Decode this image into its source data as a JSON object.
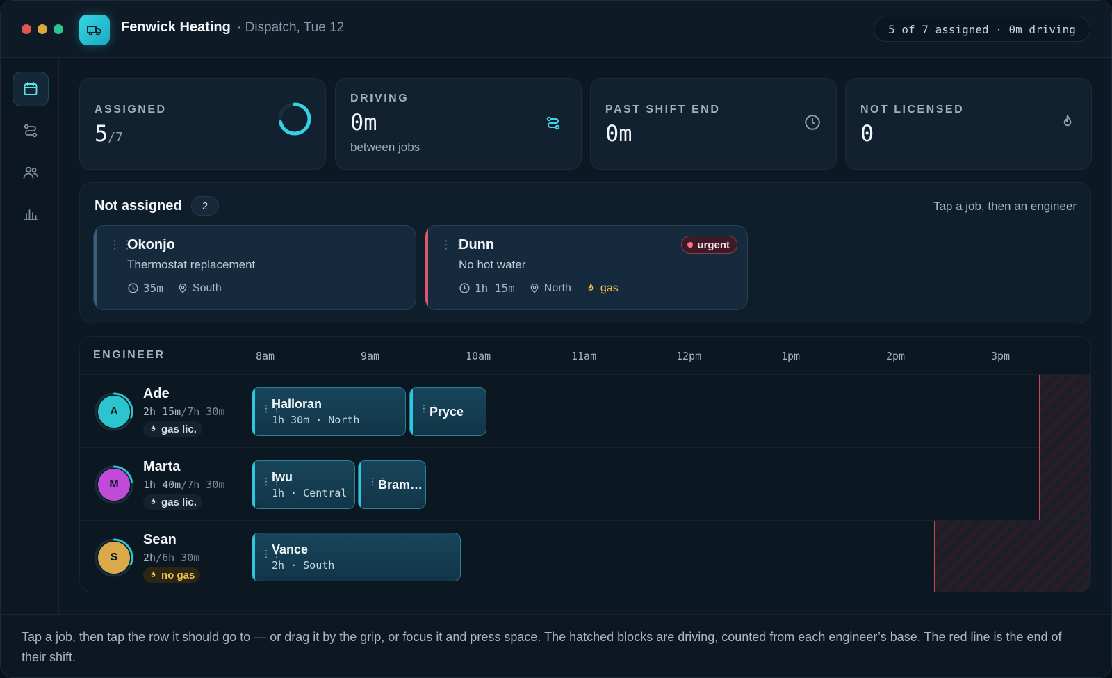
{
  "app": {
    "title": "Fenwick Heating",
    "subtitle": "· Dispatch, Tue 12",
    "summary": "5 of 7 assigned · 0m driving",
    "logo_icon": "van-icon"
  },
  "sidebar": {
    "items": [
      {
        "icon": "calendar-icon",
        "active": true
      },
      {
        "icon": "route-icon",
        "active": false
      },
      {
        "icon": "people-icon",
        "active": false
      },
      {
        "icon": "bar-chart-icon",
        "active": false
      }
    ]
  },
  "stats": {
    "assigned": {
      "label": "ASSIGNED",
      "value": "5",
      "denominator": "/7",
      "progress": 0.714
    },
    "driving": {
      "label": "DRIVING",
      "value": "0m",
      "note": "between jobs",
      "icon": "route-icon"
    },
    "past_shift": {
      "label": "PAST SHIFT END",
      "value": "0m",
      "icon": "clock-icon"
    },
    "not_licensed": {
      "label": "NOT LICENSED",
      "value": "0",
      "icon": "flame-icon"
    }
  },
  "unassigned": {
    "title": "Not assigned",
    "count": "2",
    "hint": "Tap a job, then an engineer",
    "jobs": [
      {
        "name": "Okonjo",
        "desc": "Thermostat replacement",
        "duration": "35m",
        "area": "South"
      },
      {
        "name": "Dunn",
        "desc": "No hot water",
        "duration": "1h 15m",
        "area": "North",
        "gas": "gas",
        "urgent": "urgent"
      }
    ]
  },
  "schedule": {
    "header": "ENGINEER",
    "times": [
      "8am",
      "9am",
      "10am",
      "11am",
      "12pm",
      "1pm",
      "2pm",
      "3pm"
    ],
    "engineers": [
      {
        "name": "Ade",
        "initial": "A",
        "booked": "2h 15m",
        "total": "/7h 30m",
        "license": "gas lic.",
        "color": "#2cc5cf"
      },
      {
        "name": "Marta",
        "initial": "M",
        "booked": "1h 40m",
        "total": "/7h 30m",
        "license": "gas lic.",
        "color": "#c04bd8"
      },
      {
        "name": "Sean",
        "initial": "S",
        "booked": "2h",
        "total": "/6h 30m",
        "license": "no gas",
        "color": "#d9a94a"
      }
    ],
    "blocks": {
      "halloran": {
        "name": "Halloran",
        "meta": "1h 30m · North"
      },
      "pryce": {
        "name": "Pryce"
      },
      "iwu": {
        "name": "Iwu",
        "meta": "1h · Central"
      },
      "bram": {
        "name": "Bram…"
      },
      "vance": {
        "name": "Vance",
        "meta": "2h · South"
      }
    }
  },
  "footer": {
    "text": "Tap a job, then tap the row it should go to — or drag it by the grip, or focus it and press space. The hatched blocks are driving, counted from each engineer’s base. The red line is the end of their shift."
  },
  "colors": {
    "accent": "#2fc6e0",
    "urgent": "#e0566f",
    "gas": "#f0c34f",
    "shift_end": "#c8485e"
  }
}
